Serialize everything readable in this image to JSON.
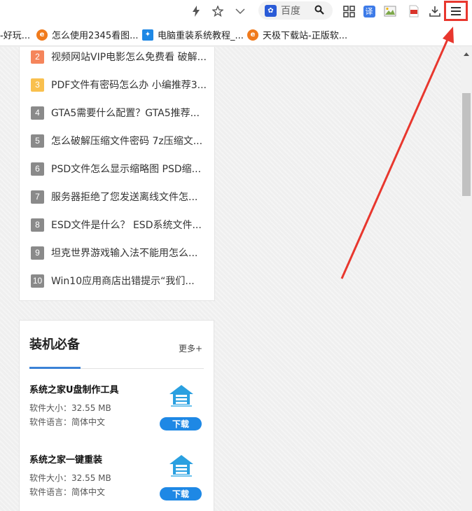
{
  "toolbar": {
    "icons": [
      "bolt-icon",
      "star-icon",
      "chevron-down-icon",
      "grid-icon",
      "translate-icon",
      "image-icon",
      "pdf-icon",
      "download-icon",
      "menu-icon"
    ],
    "search": {
      "engine_icon": "baidu-paw-icon",
      "text": "百度"
    },
    "translate_label": "译"
  },
  "bookmarks": [
    {
      "label": "-好玩...",
      "icon": "none"
    },
    {
      "label": "怎么使用2345看图...",
      "icon": "e-icon"
    },
    {
      "label": "电脑重装系统教程_...",
      "icon": "blue-icon"
    },
    {
      "label": "天极下载站-正版软...",
      "icon": "e-icon"
    }
  ],
  "ranking": [
    {
      "num": "2",
      "text": "视频网站VIP电影怎么免费看 破解..."
    },
    {
      "num": "3",
      "text": "PDF文件有密码怎么办 小编推荐3..."
    },
    {
      "num": "4",
      "text": "GTA5需要什么配置？GTA5推荐..."
    },
    {
      "num": "5",
      "text": "怎么破解压缩文件密码 7z压缩文..."
    },
    {
      "num": "6",
      "text": "PSD文件怎么显示缩略图 PSD缩..."
    },
    {
      "num": "7",
      "text": "服务器拒绝了您发送离线文件怎..."
    },
    {
      "num": "8",
      "text": "ESD文件是什么？ ESD系统文件..."
    },
    {
      "num": "9",
      "text": "坦克世界游戏输入法不能用怎么..."
    },
    {
      "num": "10",
      "text": "Win10应用商店出错提示“我们..."
    }
  ],
  "essentials": {
    "title": "装机必备",
    "more": "更多+",
    "items": [
      {
        "name": "系统之家U盘制作工具",
        "size": "软件大小：32.55 MB",
        "lang": "软件语言：简体中文",
        "button": "下载"
      },
      {
        "name": "系统之家一键重装",
        "size": "软件大小：32.55 MB",
        "lang": "软件语言：简体中文",
        "button": "下载"
      }
    ]
  },
  "colors": {
    "highlight": "#e8372e",
    "accent": "#3b82d6",
    "download_button": "#1e88e5",
    "rank2": "#f5855b",
    "rank3": "#f9c04e",
    "rank_default": "#8a8a8a"
  }
}
